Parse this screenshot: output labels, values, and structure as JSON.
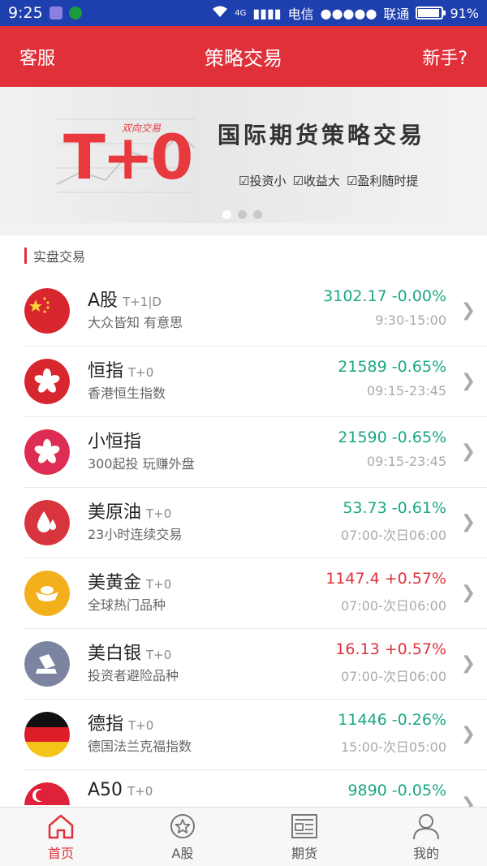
{
  "status": {
    "time": "9:25",
    "carrier1": "电信",
    "carrier2": "联通",
    "battery": "91%",
    "net": "4G"
  },
  "nav": {
    "left": "客服",
    "title": "策略交易",
    "right": "新手?"
  },
  "banner": {
    "logo": "T+0",
    "logo_sub": "双向交易",
    "headline": "国际期货策略交易",
    "tags": [
      "投资小",
      "收益大",
      "盈利随时提"
    ]
  },
  "section_title": "实盘交易",
  "items": [
    {
      "name": "A股",
      "tag": "T+1|D",
      "desc": "大众皆知 有意思",
      "price": "3102.17 -0.00%",
      "time": "9:30-15:00",
      "color": "green",
      "icon": "china-flag-icon"
    },
    {
      "name": "恒指",
      "tag": "T+0",
      "desc": "香港恒生指数",
      "price": "21589 -0.65%",
      "time": "09:15-23:45",
      "color": "green",
      "icon": "hk-flower-icon"
    },
    {
      "name": "小恒指",
      "tag": "",
      "desc": "300起投 玩赚外盘",
      "price": "21590 -0.65%",
      "time": "09:15-23:45",
      "color": "green",
      "icon": "hk-flower-icon"
    },
    {
      "name": "美原油",
      "tag": "T+0",
      "desc": "23小时连续交易",
      "price": "53.73 -0.61%",
      "time": "07:00-次日06:00",
      "color": "green",
      "icon": "oil-drop-icon"
    },
    {
      "name": "美黄金",
      "tag": "T+0",
      "desc": "全球热门品种",
      "price": "1147.4 +0.57%",
      "time": "07:00-次日06:00",
      "color": "red",
      "icon": "gold-ingot-icon"
    },
    {
      "name": "美白银",
      "tag": "T+0",
      "desc": "投资者避险品种",
      "price": "16.13 +0.57%",
      "time": "07:00-次日06:00",
      "color": "red",
      "icon": "silver-bar-icon"
    },
    {
      "name": "德指",
      "tag": "T+0",
      "desc": "德国法兰克福指数",
      "price": "11446 -0.26%",
      "time": "15:00-次日05:00",
      "color": "green",
      "icon": "germany-flag-icon"
    },
    {
      "name": "A50",
      "tag": "T+0",
      "desc": "",
      "price": "9890 -0.05%",
      "time": "",
      "color": "green",
      "icon": "singapore-flag-icon"
    }
  ],
  "tabs": [
    {
      "label": "首页",
      "icon": "home-icon"
    },
    {
      "label": "A股",
      "icon": "star-coin-icon"
    },
    {
      "label": "期货",
      "icon": "news-icon"
    },
    {
      "label": "我的",
      "icon": "user-icon"
    }
  ],
  "colors": {
    "brand": "#e0313b",
    "statusbar": "#1e3fae",
    "up": "#e0313b",
    "down": "#1aa784"
  }
}
